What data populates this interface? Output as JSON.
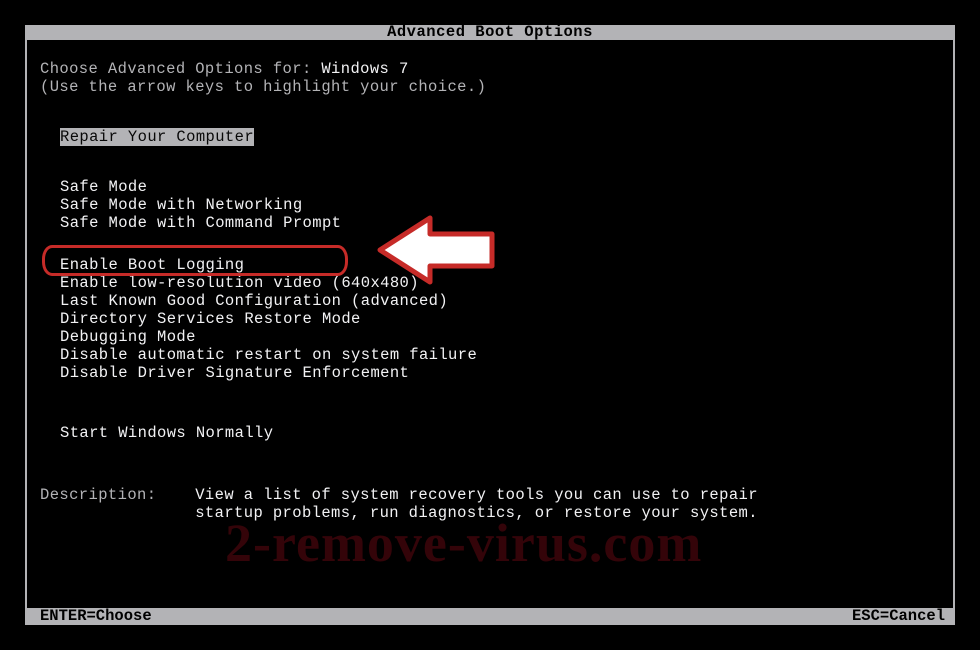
{
  "title": "Advanced Boot Options",
  "choose_prefix": "Choose Advanced Options for: ",
  "os_name": "Windows 7",
  "hint": "(Use the arrow keys to highlight your choice.)",
  "repair": "Repair Your Computer",
  "options": {
    "safe_mode": "Safe Mode",
    "safe_mode_net": "Safe Mode with Networking",
    "safe_mode_cmd": "Safe Mode with Command Prompt",
    "boot_log": "Enable Boot Logging",
    "lowres": "Enable low-resolution video (640x480)",
    "lkgc": "Last Known Good Configuration (advanced)",
    "dsrm": "Directory Services Restore Mode",
    "debug": "Debugging Mode",
    "disable_restart": "Disable automatic restart on system failure",
    "disable_sig": "Disable Driver Signature Enforcement",
    "start_normal": "Start Windows Normally"
  },
  "desc_label": "Description:",
  "desc_text1": "View a list of system recovery tools you can use to repair",
  "desc_text2": "startup problems, run diagnostics, or restore your system.",
  "footer_left": "ENTER=Choose",
  "footer_right": "ESC=Cancel",
  "watermark": "2-remove-virus.com",
  "colors": {
    "highlight": "#c62b28"
  }
}
